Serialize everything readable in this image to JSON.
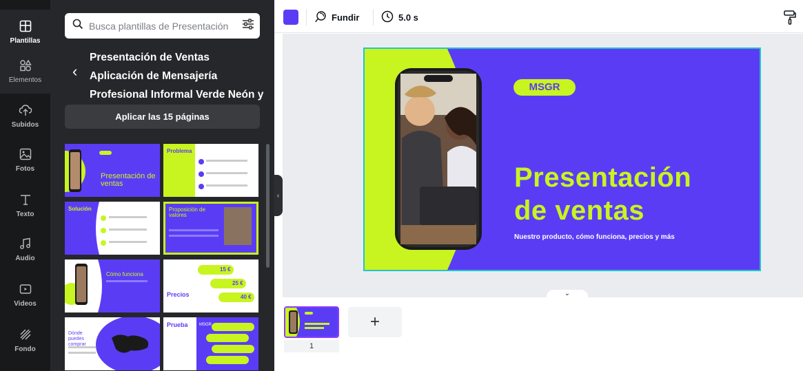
{
  "sidebar": {
    "items": [
      {
        "label": "Plantillas",
        "icon": "templates-icon",
        "active": true
      },
      {
        "label": "Elementos",
        "icon": "elements-icon"
      },
      {
        "label": "Subidos",
        "icon": "upload-cloud-icon"
      },
      {
        "label": "Fotos",
        "icon": "photos-icon"
      },
      {
        "label": "Texto",
        "icon": "text-icon"
      },
      {
        "label": "Audio",
        "icon": "music-note-icon"
      },
      {
        "label": "Videos",
        "icon": "video-icon"
      },
      {
        "label": "Fondo",
        "icon": "background-pattern-icon"
      }
    ]
  },
  "panel": {
    "search_placeholder": "Busca plantillas de Presentación",
    "template_title": "Presentación de Ventas Aplicación de Mensajería Profesional Informal Verde Neón y Morado",
    "apply_label": "Aplicar las 15 páginas",
    "thumbnails": [
      {
        "title": "Presentación de ventas",
        "tag": "MSGR"
      },
      {
        "title": "Problema"
      },
      {
        "title": "Solución"
      },
      {
        "title": "Proposición de valores"
      },
      {
        "title": "Cómo funciona"
      },
      {
        "title": "Precios",
        "prices": [
          "15 €",
          "25 €",
          "40 €"
        ]
      },
      {
        "title": "Dónde puedes comprar"
      },
      {
        "title": "Prueba",
        "tag": "MSGR"
      }
    ]
  },
  "toolbar": {
    "transition_label": "Fundir",
    "duration_label": "5.0 s",
    "swatch_color": "#5b3cf5"
  },
  "slide": {
    "tag": "MSGR",
    "title_line1": "Presentación",
    "title_line2": "de ventas",
    "subtitle": "Nuestro producto, cómo funciona, precios y más"
  },
  "pages": {
    "current_page": "1",
    "add_label": "+"
  },
  "colors": {
    "brand_purple": "#5b3cf5",
    "neon_green": "#c8f51f",
    "panel_bg": "#25272a",
    "rail_bg": "#18191b"
  }
}
